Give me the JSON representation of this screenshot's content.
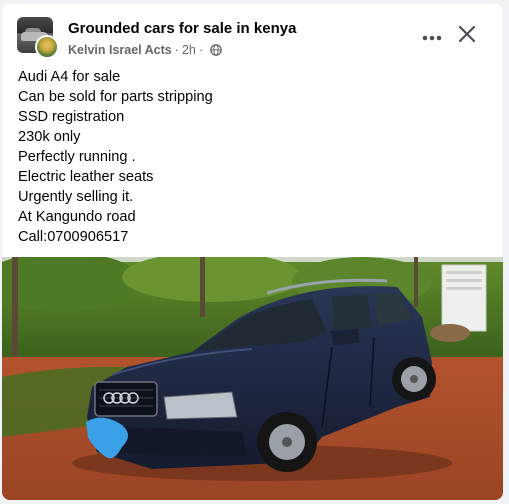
{
  "post": {
    "group_name": "Grounded cars for sale in kenya",
    "author": "Kelvin Israel Acts",
    "time": "2h",
    "separator": "·",
    "privacy_icon": "globe-icon",
    "lines": [
      "Audi A4 for sale",
      "Can be sold for parts stripping",
      "SSD registration",
      "230k only",
      "Perfectly running .",
      "Electric leather seats",
      "Urgently selling it.",
      "At Kangundo road",
      "Call:0700906517"
    ]
  },
  "actions": {
    "more_icon": "more-horizontal-icon",
    "close_icon": "close-icon"
  },
  "colors": {
    "card_bg": "#ffffff",
    "page_bg": "#f0f2f5",
    "text_primary": "#050505",
    "text_secondary": "#65676b",
    "car_body": "#1b2540"
  }
}
